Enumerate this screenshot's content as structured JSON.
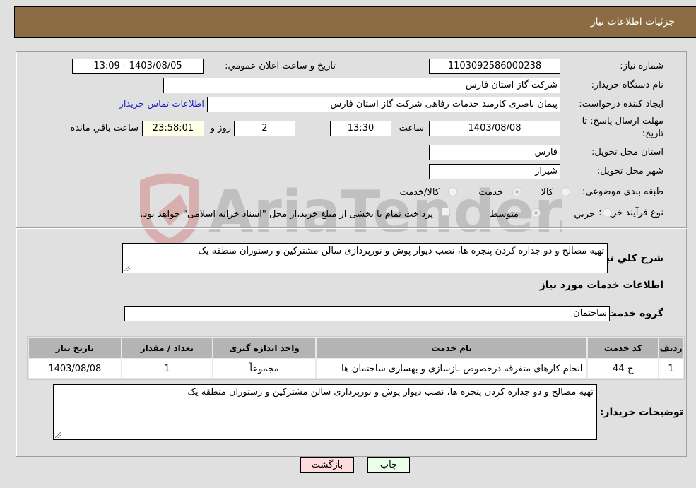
{
  "header": {
    "title": "جزئیات اطلاعات نیاز"
  },
  "form": {
    "need_number": {
      "label": "شماره نیاز:",
      "value": "1103092586000238"
    },
    "announce_datetime": {
      "label": "تاریخ و ساعت اعلان عمومي:",
      "value": "1403/08/05 - 13:09"
    },
    "buyer_org": {
      "label": "نام دستگاه خريدار:",
      "value": "شرکت گاز استان فارس"
    },
    "requester": {
      "label": "ایجاد کننده درخواست:",
      "value": "پیمان ناصری کارمند خدمات رفاهی شرکت گاز استان فارس"
    },
    "buyer_contact_link": "اطلاعات تماس خريدار",
    "deadline": {
      "label_line1": "مهلت ارسال پاسخ: تا",
      "label_line2": "تاریخ:",
      "date": "1403/08/08",
      "time_label": "ساعت",
      "time": "13:30",
      "days": "2",
      "days_label": "روز و",
      "remaining": "23:58:01",
      "remaining_label": "ساعت باقي مانده"
    },
    "delivery_province": {
      "label": "استان محل تحویل:",
      "value": "فارس"
    },
    "delivery_city": {
      "label": "شهر محل تحویل:",
      "value": "شیراز"
    },
    "category": {
      "label": "طبقه بندی موضوعی:",
      "options": [
        "کالا",
        "خدمت",
        "کالا/خدمت"
      ],
      "selected": "خدمت"
    },
    "purchase_type": {
      "label": "نوع فرآیند خرید :",
      "options": [
        "جزيي",
        "متوسط"
      ],
      "selected": "متوسط",
      "treasury_note": "پرداخت تمام یا بخشی از مبلغ خرید،از محل \"اسناد خزانه اسلامی\" خواهد بود.",
      "treasury_checked": false
    }
  },
  "description": {
    "label": "شرح كلي نياز:",
    "value": "تهیه مصالح و دو جداره کردن پنجره ها، نصب دیوار پوش و نورپردازی سالن مشترکین و رستوران منطقه یک"
  },
  "services": {
    "section_title": "اطلاعات خدمات مورد نیاز",
    "group_label": "گروه خدمت:",
    "group_value": "ساختمان",
    "columns": [
      "ردیف",
      "کد خدمت",
      "نام خدمت",
      "واحد اندازه گیری",
      "تعداد / مقدار",
      "تاریخ نیاز"
    ],
    "rows": [
      {
        "row": "1",
        "code": "ج-44",
        "name": "انجام کارهای متفرقه درخصوص بازسازی و بهسازی ساختمان ها",
        "unit": "مجموعاً",
        "qty": "1",
        "date": "1403/08/08"
      }
    ]
  },
  "buyer_notes": {
    "label": "توضیحات خریدار:",
    "value": "تهیه مصالح و دو جداره کردن پنجره ها، نصب دیوار پوش و نورپردازی سالن مشترکین و رستوران منطقه یک"
  },
  "buttons": {
    "print": "چاپ",
    "back": "بازگشت"
  },
  "watermark": {
    "text": "AriaTender.net"
  }
}
